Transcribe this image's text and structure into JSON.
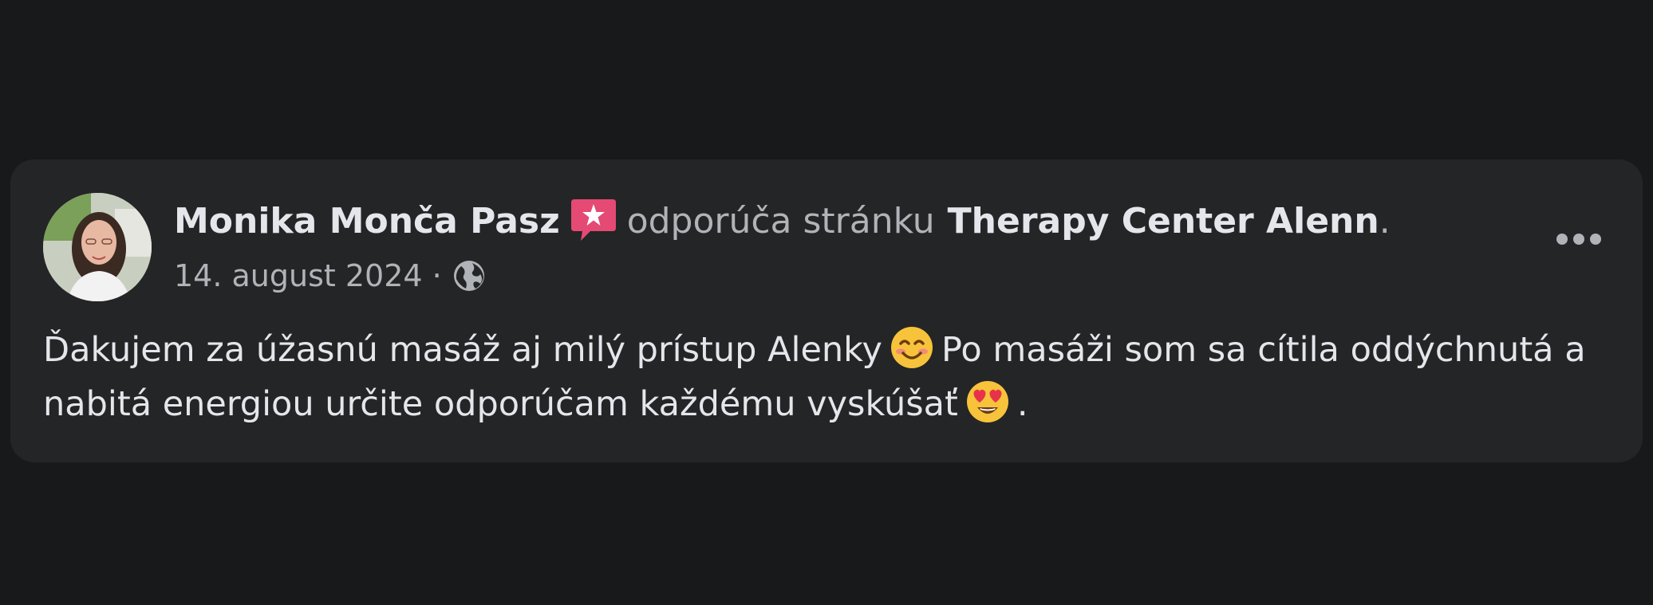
{
  "post": {
    "author_name": "Monika Monča Pasz",
    "action_text": "odporúča stránku",
    "page_name": "Therapy Center Alenn",
    "period": ".",
    "date": "14. august 2024",
    "separator": "·",
    "audience_icon": "globe-icon",
    "recommend_icon": "recommendation-badge-icon",
    "more_icon": "more-options-icon",
    "text_line1_part1": "Ďakujem za úžasnú masáž aj milý prístup Alenky",
    "emoji1": "smiling-face-icon",
    "text_line1_part2": "Po masáži som sa cítila oddýchnutá a",
    "text_line2_part1": "nabitá energiou určite odporúčam každému vyskúšať",
    "emoji2": "heart-eyes-icon",
    "text_line2_part2": "."
  },
  "colors": {
    "background": "#18191a",
    "card": "#242526",
    "primary_text": "#e4e6eb",
    "secondary_text": "#b0b3b8",
    "badge": "#e44a73"
  }
}
